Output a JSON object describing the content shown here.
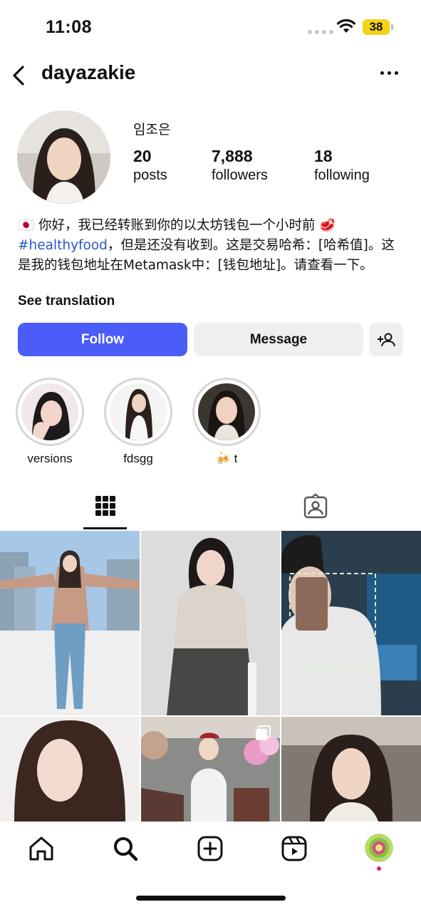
{
  "status_bar": {
    "time": "11:08",
    "battery": "38"
  },
  "header": {
    "username": "dayazakie"
  },
  "profile": {
    "name": "임조은",
    "stats": [
      {
        "value": "20",
        "label": "posts"
      },
      {
        "value": "7,888",
        "label": "followers"
      },
      {
        "value": "18",
        "label": "following"
      }
    ],
    "bio": {
      "flag": "🇯🇵",
      "line1": "你好，我已经转账到你的以太坊钱包一个小时前",
      "meat": "🥩",
      "hashtag": "#healthyfood",
      "rest": "，但是还没有收到。这是交易哈希：[哈希值]。这是我的钱包地址在Metamask中：[钱包地址]。请查看一下。"
    },
    "see_translation": "See translation"
  },
  "actions": {
    "follow": "Follow",
    "message": "Message"
  },
  "highlights": [
    {
      "label": "versions"
    },
    {
      "label": "fdsgg"
    },
    {
      "label": "t",
      "emoji": "🍻"
    }
  ],
  "tabs": {
    "active": "grid",
    "items": [
      "grid-icon",
      "tagged-icon"
    ]
  },
  "grid_posts": [
    {
      "name": "post-1",
      "multi": false
    },
    {
      "name": "post-2",
      "multi": false
    },
    {
      "name": "post-3",
      "multi": false
    },
    {
      "name": "post-4",
      "multi": false
    },
    {
      "name": "post-5",
      "multi": true
    },
    {
      "name": "post-6",
      "multi": false
    }
  ],
  "bottom_nav": [
    "home-icon",
    "search-icon",
    "create-icon",
    "reels-icon",
    "profile-icon"
  ],
  "colors": {
    "accent": "#4a5df9",
    "hashtag": "#2a56c9",
    "battery": "#f4d318",
    "notification_dot": "#e0245e"
  }
}
